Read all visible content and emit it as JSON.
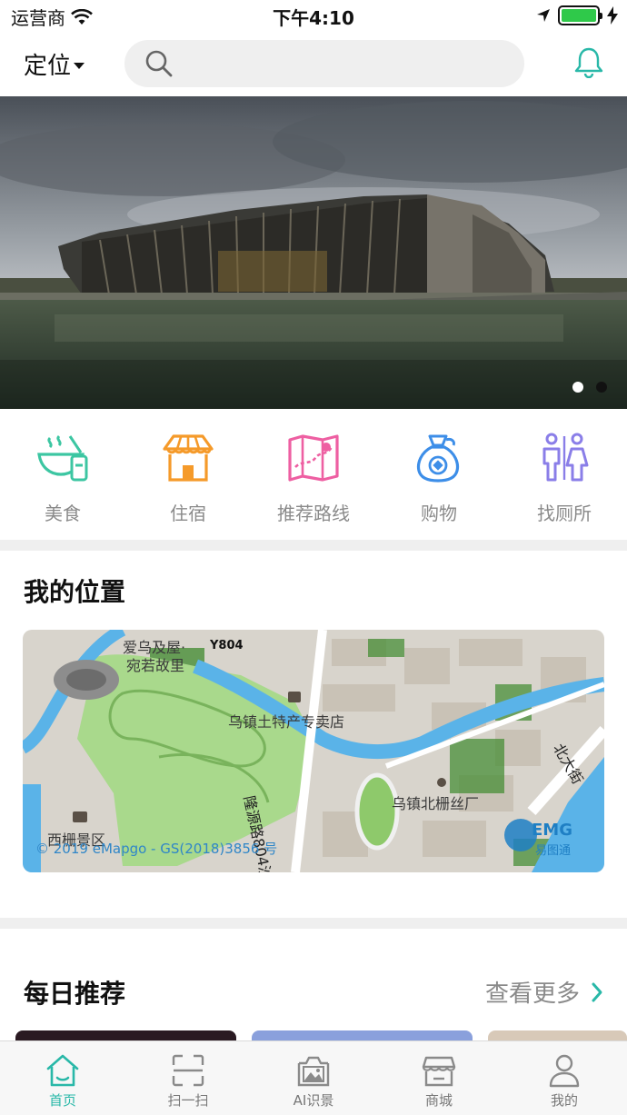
{
  "status_bar": {
    "carrier": "运营商",
    "time": "下午4:10"
  },
  "header": {
    "location_label": "定位",
    "search_placeholder": ""
  },
  "banner": {
    "active_index": 0,
    "dot_count": 2
  },
  "categories": [
    {
      "label": "美食",
      "icon": "food-bowl-icon",
      "color": "#3cc6a2"
    },
    {
      "label": "住宿",
      "icon": "house-icon",
      "color": "#f59a2a"
    },
    {
      "label": "推荐路线",
      "icon": "map-route-icon",
      "color": "#ee5fa2"
    },
    {
      "label": "购物",
      "icon": "money-bag-icon",
      "color": "#3d8ee8"
    },
    {
      "label": "找厕所",
      "icon": "restroom-icon",
      "color": "#8a7ee8"
    }
  ],
  "my_location": {
    "title": "我的位置",
    "map_labels": {
      "place1_line1": "爱乌及屋·",
      "place1_line2": "宛若故里",
      "road_code": "Y804",
      "shop": "乌镇土特产专卖店",
      "road_long": "隆源路804沙道",
      "factory": "乌镇北栅丝厂",
      "street": "北大街",
      "scenic": "西栅景区",
      "copyright": "© 2019 eMapgo - GS(2018)3856 号",
      "logo_text": "EMG",
      "logo_sub": "易图通"
    }
  },
  "daily": {
    "title": "每日推荐",
    "more_label": "查看更多"
  },
  "tabs": [
    {
      "label": "首页",
      "icon": "home-icon",
      "active": true
    },
    {
      "label": "扫一扫",
      "icon": "scan-icon",
      "active": false
    },
    {
      "label": "AI识景",
      "icon": "image-recognition-icon",
      "active": false
    },
    {
      "label": "商城",
      "icon": "shop-icon",
      "active": false
    },
    {
      "label": "我的",
      "icon": "profile-icon",
      "active": false
    }
  ],
  "colors": {
    "accent": "#29b8a8",
    "section_gap": "#efefef"
  }
}
